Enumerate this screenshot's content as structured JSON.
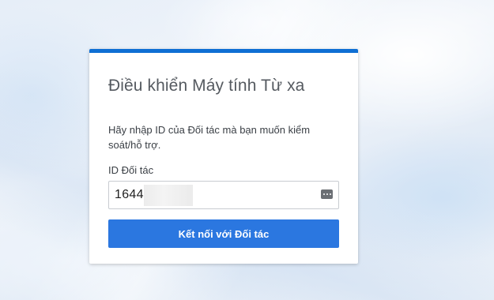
{
  "dialog": {
    "title": "Điều khiển Máy tính Từ xa",
    "description": "Hãy nhập ID của Đối tác mà bạn muốn kiểm soát/hỗ trợ.",
    "partner_id_label": "ID Đối tác",
    "partner_id_value": "1644",
    "partner_id_icon": "password-dots-icon",
    "connect_button_label": "Kết nối với Đối tác"
  },
  "colors": {
    "accent": "#0e6fd4",
    "button": "#2b77e0"
  }
}
